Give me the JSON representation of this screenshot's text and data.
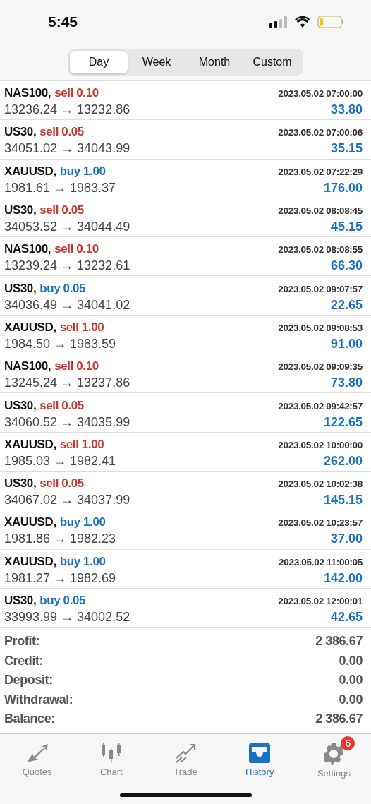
{
  "status_bar": {
    "time": "5:45"
  },
  "period_tabs": [
    {
      "label": "Day",
      "selected": true
    },
    {
      "label": "Week",
      "selected": false
    },
    {
      "label": "Month",
      "selected": false
    },
    {
      "label": "Custom",
      "selected": false
    }
  ],
  "deals": [
    {
      "symbol": "NAS100,",
      "side": "sell",
      "amount": "0.10",
      "time": "2023.05.02 07:00:00",
      "prices": "13236.24 → 13232.86",
      "profit": "33.80"
    },
    {
      "symbol": "US30,",
      "side": "sell",
      "amount": "0.05",
      "time": "2023.05.02 07:00:06",
      "prices": "34051.02 → 34043.99",
      "profit": "35.15"
    },
    {
      "symbol": "XAUUSD,",
      "side": "buy",
      "amount": "1.00",
      "time": "2023.05.02 07:22:29",
      "prices": "1981.61 → 1983.37",
      "profit": "176.00"
    },
    {
      "symbol": "US30,",
      "side": "sell",
      "amount": "0.05",
      "time": "2023.05.02 08:08:45",
      "prices": "34053.52 → 34044.49",
      "profit": "45.15"
    },
    {
      "symbol": "NAS100,",
      "side": "sell",
      "amount": "0.10",
      "time": "2023.05.02 08:08:55",
      "prices": "13239.24 → 13232.61",
      "profit": "66.30"
    },
    {
      "symbol": "US30,",
      "side": "buy",
      "amount": "0.05",
      "time": "2023.05.02 09:07:57",
      "prices": "34036.49 → 34041.02",
      "profit": "22.65"
    },
    {
      "symbol": "XAUUSD,",
      "side": "sell",
      "amount": "1.00",
      "time": "2023.05.02 09:08:53",
      "prices": "1984.50 → 1983.59",
      "profit": "91.00"
    },
    {
      "symbol": "NAS100,",
      "side": "sell",
      "amount": "0.10",
      "time": "2023.05.02 09:09:35",
      "prices": "13245.24 → 13237.86",
      "profit": "73.80"
    },
    {
      "symbol": "US30,",
      "side": "sell",
      "amount": "0.05",
      "time": "2023.05.02 09:42:57",
      "prices": "34060.52 → 34035.99",
      "profit": "122.65"
    },
    {
      "symbol": "XAUUSD,",
      "side": "sell",
      "amount": "1.00",
      "time": "2023.05.02 10:00:00",
      "prices": "1985.03 → 1982.41",
      "profit": "262.00"
    },
    {
      "symbol": "US30,",
      "side": "sell",
      "amount": "0.05",
      "time": "2023.05.02 10:02:38",
      "prices": "34067.02 → 34037.99",
      "profit": "145.15"
    },
    {
      "symbol": "XAUUSD,",
      "side": "buy",
      "amount": "1.00",
      "time": "2023.05.02 10:23:57",
      "prices": "1981.86 → 1982.23",
      "profit": "37.00"
    },
    {
      "symbol": "XAUUSD,",
      "side": "buy",
      "amount": "1.00",
      "time": "2023.05.02 11:00:05",
      "prices": "1981.27 → 1982.69",
      "profit": "142.00"
    },
    {
      "symbol": "US30,",
      "side": "buy",
      "amount": "0.05",
      "time": "2023.05.02 12:00:01",
      "prices": "33993.99 → 34002.52",
      "profit": "42.65"
    }
  ],
  "summary": [
    {
      "label": "Profit:",
      "value": "2 386.67"
    },
    {
      "label": "Credit:",
      "value": "0.00"
    },
    {
      "label": "Deposit:",
      "value": "0.00"
    },
    {
      "label": "Withdrawal:",
      "value": "0.00"
    },
    {
      "label": "Balance:",
      "value": "2 386.67"
    }
  ],
  "tab_bar": [
    {
      "kind": "quotes",
      "label": "Quotes",
      "selected": false
    },
    {
      "kind": "chart",
      "label": "Chart",
      "selected": false
    },
    {
      "kind": "trade",
      "label": "Trade",
      "selected": false
    },
    {
      "kind": "history",
      "label": "History",
      "selected": true
    },
    {
      "kind": "settings",
      "label": "Settings",
      "selected": false,
      "badge": "6"
    }
  ]
}
